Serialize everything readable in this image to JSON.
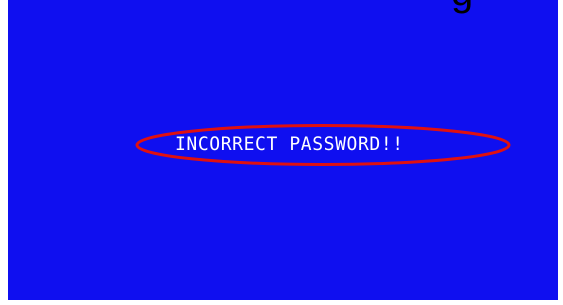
{
  "screen": {
    "background_color": "#0f0ff0",
    "message": "INCORRECT PASSWORD!!",
    "message_color": "#ffffff"
  },
  "annotation": {
    "ellipse_color": "#e01010"
  },
  "top_clipped_text": "g"
}
